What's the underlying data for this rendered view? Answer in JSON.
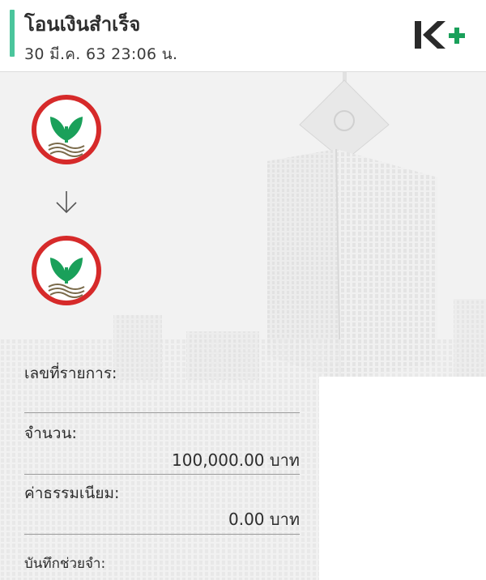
{
  "header": {
    "title": "โอนเงินสำเร็จ",
    "datetime": "30 มี.ค. 63  23:06 น.",
    "accent_color": "#4bc59c",
    "app_logo": "kplus-logo"
  },
  "transfer": {
    "from_logo": "kasikornbank-logo",
    "to_logo": "kasikornbank-logo",
    "direction_icon": "arrow-down-icon"
  },
  "details": {
    "reference_label": "เลขที่รายการ:",
    "amount_label": "จำนวน:",
    "amount_value": "100,000.00 บาท",
    "fee_label": "ค่าธรรมเนียม:",
    "fee_value": "0.00 บาท",
    "memo_label": "บันทึกช่วยจำ:"
  },
  "colors": {
    "brand_green": "#1aa05a",
    "logo_red": "#d62a2a"
  }
}
